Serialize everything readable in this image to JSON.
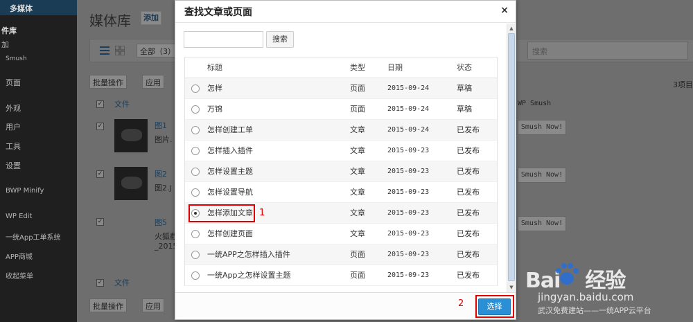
{
  "sidebar": {
    "items": [
      {
        "label": "多媒体"
      },
      {
        "label": "件库"
      },
      {
        "label": "加"
      },
      {
        "label": "Smush"
      },
      {
        "label": "页面"
      },
      {
        "label": "外观"
      },
      {
        "label": "用户"
      },
      {
        "label": "工具"
      },
      {
        "label": "设置"
      },
      {
        "label": "BWP Minify"
      },
      {
        "label": "WP Edit"
      },
      {
        "label": "一统App工单系统"
      },
      {
        "label": "APP商城"
      },
      {
        "label": "收起菜单"
      }
    ]
  },
  "background": {
    "heading": "媒体库",
    "add_label": "添加",
    "filter_label": "全部（3）",
    "search_placeholder": "搜索",
    "bulk_label": "批量操作",
    "apply_label": "应用",
    "file_col": "文件",
    "count_label": "3项目",
    "smush_col": "WP Smush",
    "smush_button": "Smush Now!",
    "files": [
      {
        "title": "图1",
        "sub": "图片."
      },
      {
        "title": "图2",
        "sub": "图2.j"
      },
      {
        "title": "图5",
        "sub": "火狐截",
        "sub2": "_2015"
      }
    ]
  },
  "modal": {
    "title": "查找文章或页面",
    "close_icon": "×",
    "search_button": "搜索",
    "search_value": "",
    "columns": {
      "title": "标题",
      "type": "类型",
      "date": "日期",
      "status": "状态"
    },
    "rows": [
      {
        "title": "怎样",
        "type": "页面",
        "date": "2015-09-24",
        "status": "草稿",
        "selected": false
      },
      {
        "title": "万锦",
        "type": "页面",
        "date": "2015-09-24",
        "status": "草稿",
        "selected": false
      },
      {
        "title": "怎样创建工单",
        "type": "文章",
        "date": "2015-09-24",
        "status": "已发布",
        "selected": false
      },
      {
        "title": "怎样插入插件",
        "type": "文章",
        "date": "2015-09-23",
        "status": "已发布",
        "selected": false
      },
      {
        "title": "怎样设置主题",
        "type": "文章",
        "date": "2015-09-23",
        "status": "已发布",
        "selected": false
      },
      {
        "title": "怎样设置导航",
        "type": "文章",
        "date": "2015-09-23",
        "status": "已发布",
        "selected": false
      },
      {
        "title": "怎样添加文章",
        "type": "文章",
        "date": "2015-09-23",
        "status": "已发布",
        "selected": true
      },
      {
        "title": "怎样创建页面",
        "type": "文章",
        "date": "2015-09-23",
        "status": "已发布",
        "selected": false
      },
      {
        "title": "一统APP之怎样插入插件",
        "type": "页面",
        "date": "2015-09-23",
        "status": "已发布",
        "selected": false
      },
      {
        "title": "一统App之怎样设置主题",
        "type": "页面",
        "date": "2015-09-23",
        "status": "已发布",
        "selected": false
      }
    ],
    "select_button": "选择",
    "annotation_1": "1",
    "annotation_2": "2"
  },
  "watermark": {
    "logo": "Bai",
    "logo2": "经验",
    "url": "jingyan.baidu.com",
    "sub": "武汉免费建站——一统APP云平台"
  },
  "colors": {
    "accent": "#2a8fd4",
    "annotation": "#e00000",
    "sidebar_bg": "#1f1f1f"
  }
}
